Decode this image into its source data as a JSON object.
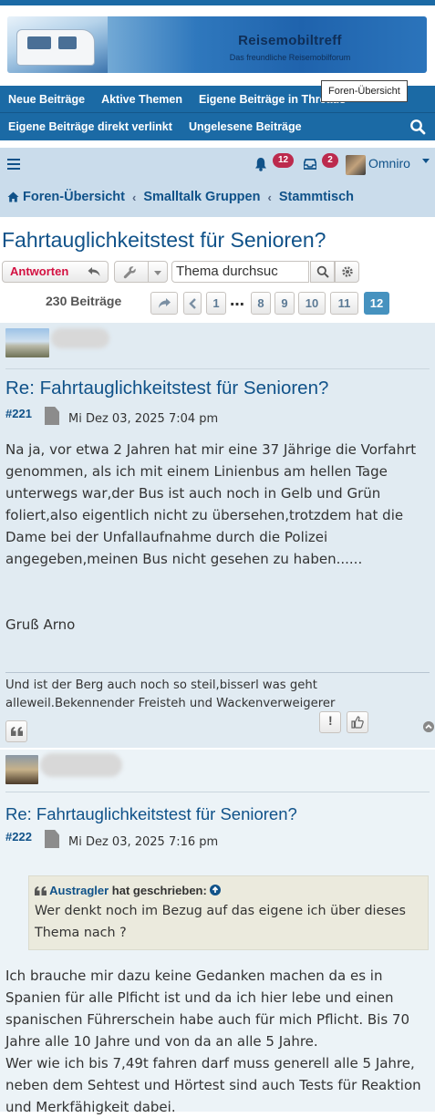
{
  "banner": {
    "title": "Reisemobiltreff",
    "subtitle": "Das freundliche Reisemobilforum"
  },
  "tooltip": {
    "text": "Foren-Übersicht"
  },
  "nav": {
    "row1": [
      "Neue Beiträge",
      "Aktive Themen",
      "Eigene Beiträge in Threads"
    ],
    "row2": [
      "Eigene Beiträge direkt verlinkt",
      "Ungelesene Beiträge"
    ],
    "search_icon": "search-icon"
  },
  "user_bar": {
    "notifications_count": "12",
    "messages_count": "2",
    "username": "Omniro"
  },
  "breadcrumbs": [
    "Foren-Übersicht",
    "Smalltalk Gruppen",
    "Stammtisch"
  ],
  "topic": {
    "title": "Fahrtauglichkeitstest für Senioren?",
    "reply_label": "Antworten",
    "search_placeholder": "Thema durchsuchen",
    "search_value": "Thema durchsuc",
    "post_count": "230 Beiträge",
    "pages": [
      "1",
      "…",
      "8",
      "9",
      "10",
      "11",
      "12"
    ],
    "current_page": "12"
  },
  "posts": [
    {
      "subject": "Re: Fahrtauglichkeitstest für Senioren?",
      "number": "#221",
      "date": "Mi Dez 03, 2025 7:04 pm",
      "body": [
        "Na ja, vor etwa 2 Jahren hat mir eine 37 Jährige die Vorfahrt genommen, als ich mit einem Linienbus am hellen Tage unterwegs war,der Bus ist auch noch in Gelb und Grün foliert,also eigentlich nicht zu übersehen,trotzdem hat die Dame bei der Unfallaufnahme durch die Polizei angegeben,meinen Bus nicht gesehen zu haben......",
        "Gruß Arno"
      ],
      "signature": "Und ist der Berg auch noch so steil,bisserl was geht alleweil.Bekennender Freisteh und Wackenverweigerer"
    },
    {
      "subject": "Re: Fahrtauglichkeitstest für Senioren?",
      "number": "#222",
      "date": "Mi Dez 03, 2025 7:16 pm",
      "quote": {
        "author": "Austragler",
        "wrote": "hat geschrieben:",
        "text": "Wer denkt noch im Bezug auf das eigene ich über dieses Thema nach ?"
      },
      "body": [
        "Ich brauche mir dazu keine Gedanken machen da es in Spanien für alle Plficht ist und da ich hier lebe und einen spanischen Führerschein habe auch für mich Pflicht. Bis 70 Jahre alle 10 Jahre und von da an alle 5 Jahre.",
        "Wer wie ich bis 7,49t fahren darf muss generell alle 5 Jahre, neben dem Sehtest und Hörtest sind auch Tests für Reaktion und Merkfähigkeit dabei."
      ]
    }
  ],
  "colors": {
    "primary": "#1b6aa5",
    "link": "#105289",
    "reply": "#d31141",
    "badge": "#bc2a4d",
    "post_bg_1": "#e1ebf2",
    "post_bg_2": "#ecf3f7",
    "quote_bg": "#ebeadd"
  }
}
